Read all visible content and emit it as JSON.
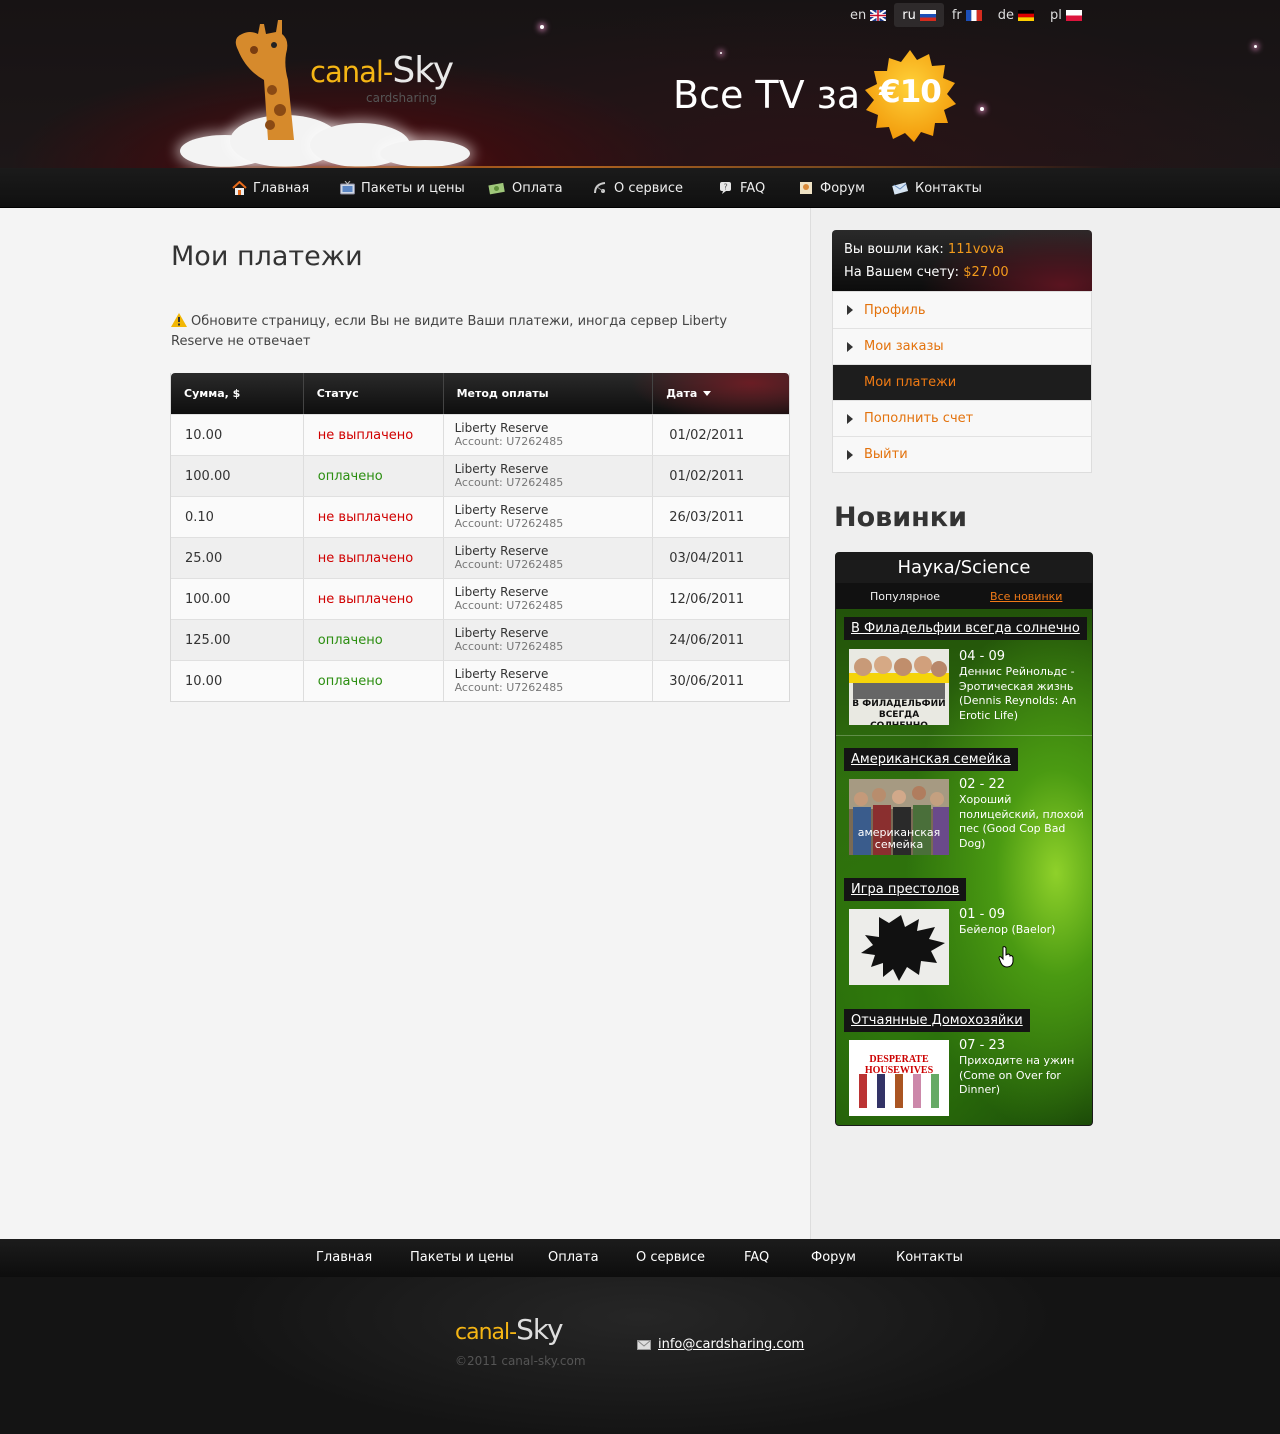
{
  "header": {
    "logo_canal": "canal-",
    "logo_sky": "Sky",
    "logo_sub": "cardsharing",
    "languages": [
      {
        "code": "en",
        "active": false
      },
      {
        "code": "ru",
        "active": true
      },
      {
        "code": "fr",
        "active": false
      },
      {
        "code": "de",
        "active": false
      },
      {
        "code": "pl",
        "active": false
      }
    ],
    "promo_text": "Все TV за",
    "price": "€10"
  },
  "nav": {
    "items": [
      {
        "label": "Главная",
        "icon": "home-icon"
      },
      {
        "label": "Пакеты и цены",
        "icon": "tv-icon"
      },
      {
        "label": "Оплата",
        "icon": "money-icon"
      },
      {
        "label": "О сервисе",
        "icon": "satellite-icon"
      },
      {
        "label": "FAQ",
        "icon": "question-icon"
      },
      {
        "label": "Форум",
        "icon": "forum-icon"
      },
      {
        "label": "Контакты",
        "icon": "contacts-icon"
      }
    ]
  },
  "main": {
    "title": "Мои платежи",
    "notice": "Обновите страницу, если Вы не видите Ваши платежи, иногда сервер Liberty Reserve не отвечает",
    "table": {
      "headers": [
        "Сумма, $",
        "Статус",
        "Метод оплаты",
        "Дата"
      ],
      "rows": [
        {
          "amount": "10.00",
          "status": "не выплачено",
          "paid": false,
          "method": "Liberty Reserve",
          "account": "Account: U7262485",
          "date": "01/02/2011"
        },
        {
          "amount": "100.00",
          "status": "оплачено",
          "paid": true,
          "method": "Liberty Reserve",
          "account": "Account: U7262485",
          "date": "01/02/2011"
        },
        {
          "amount": "0.10",
          "status": "не выплачено",
          "paid": false,
          "method": "Liberty Reserve",
          "account": "Account: U7262485",
          "date": "26/03/2011"
        },
        {
          "amount": "25.00",
          "status": "не выплачено",
          "paid": false,
          "method": "Liberty Reserve",
          "account": "Account: U7262485",
          "date": "03/04/2011"
        },
        {
          "amount": "100.00",
          "status": "не выплачено",
          "paid": false,
          "method": "Liberty Reserve",
          "account": "Account: U7262485",
          "date": "12/06/2011"
        },
        {
          "amount": "125.00",
          "status": "оплачено",
          "paid": true,
          "method": "Liberty Reserve",
          "account": "Account: U7262485",
          "date": "24/06/2011"
        },
        {
          "amount": "10.00",
          "status": "оплачено",
          "paid": true,
          "method": "Liberty Reserve",
          "account": "Account: U7262485",
          "date": "30/06/2011"
        }
      ]
    }
  },
  "sidebar": {
    "logged_in_label": "Вы вошли как:",
    "username": "111vova",
    "balance_label": "На Вашем счету:",
    "balance": "$27.00",
    "menu": [
      {
        "label": "Профиль",
        "active": false
      },
      {
        "label": "Мои заказы",
        "active": false
      },
      {
        "label": "Мои платежи",
        "active": true
      },
      {
        "label": "Пополнить счет",
        "active": false
      },
      {
        "label": "Выйти",
        "active": false
      }
    ],
    "news_heading": "Новинки",
    "news_category": "Наука/Science",
    "tab_popular": "Популярное",
    "tab_all": "Все новинки",
    "news": [
      {
        "show": "В Филадельфии всегда солнечно",
        "episode": "04 - 09",
        "desc": "Деннис Рейнольдс - Эротическая жизнь (Dennis Reynolds: An Erotic Life)",
        "thumb_text": "В ФИЛАДЕЛЬФИИ ВСЕГДА СОЛНЕЧНО"
      },
      {
        "show": "Американская семейка",
        "episode": "02 - 22",
        "desc": "Хороший полицейский, плохой пес (Good Cop Bad Dog)",
        "thumb_text": "американская семейка"
      },
      {
        "show": "Игра престолов",
        "episode": "01 - 09",
        "desc": "Бейелор (Baelor)",
        "thumb_text": ""
      },
      {
        "show": "Отчаянные Домохозяйки",
        "episode": "07 - 23",
        "desc": "Приходите на ужин (Come on Over for Dinner)",
        "thumb_text": "DESPERATE HOUSEWIVES"
      }
    ]
  },
  "footer": {
    "nav": [
      "Главная",
      "Пакеты и цены",
      "Оплата",
      "О сервисе",
      "FAQ",
      "Форум",
      "Контакты"
    ],
    "logo_canal": "canal-",
    "logo_sky": "Sky",
    "copyright": "©2011 canal-sky.com",
    "email": "info@cardsharing.com"
  }
}
